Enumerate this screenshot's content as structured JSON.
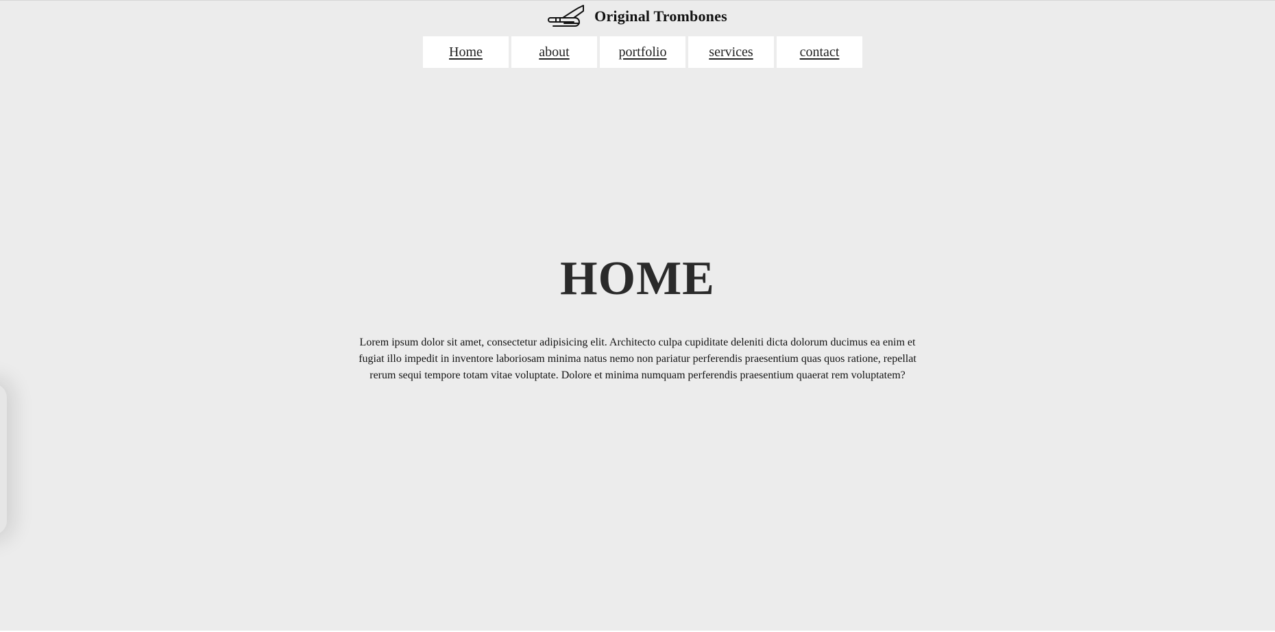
{
  "header": {
    "logo_icon": "trombone-icon",
    "site_title": "Original Trombones"
  },
  "nav": {
    "items": [
      {
        "label": "Home"
      },
      {
        "label": "about"
      },
      {
        "label": "portfolio"
      },
      {
        "label": "services"
      },
      {
        "label": "contact"
      }
    ]
  },
  "hero": {
    "title": "HOME",
    "body": "Lorem ipsum dolor sit amet, consectetur adipisicing elit. Architecto culpa cupiditate deleniti dicta dolorum ducimus ea enim et fugiat illo impedit in inventore laboriosam minima natus nemo non pariatur perferendis praesentium quas quos ratione, repellat rerum sequi tempore totam vitae voluptate. Dolore et minima numquam perferendis praesentium quaerat rem voluptatem?"
  },
  "colors": {
    "background": "#ececec",
    "nav_background": "#ffffff",
    "heading": "#2a2a2a"
  }
}
